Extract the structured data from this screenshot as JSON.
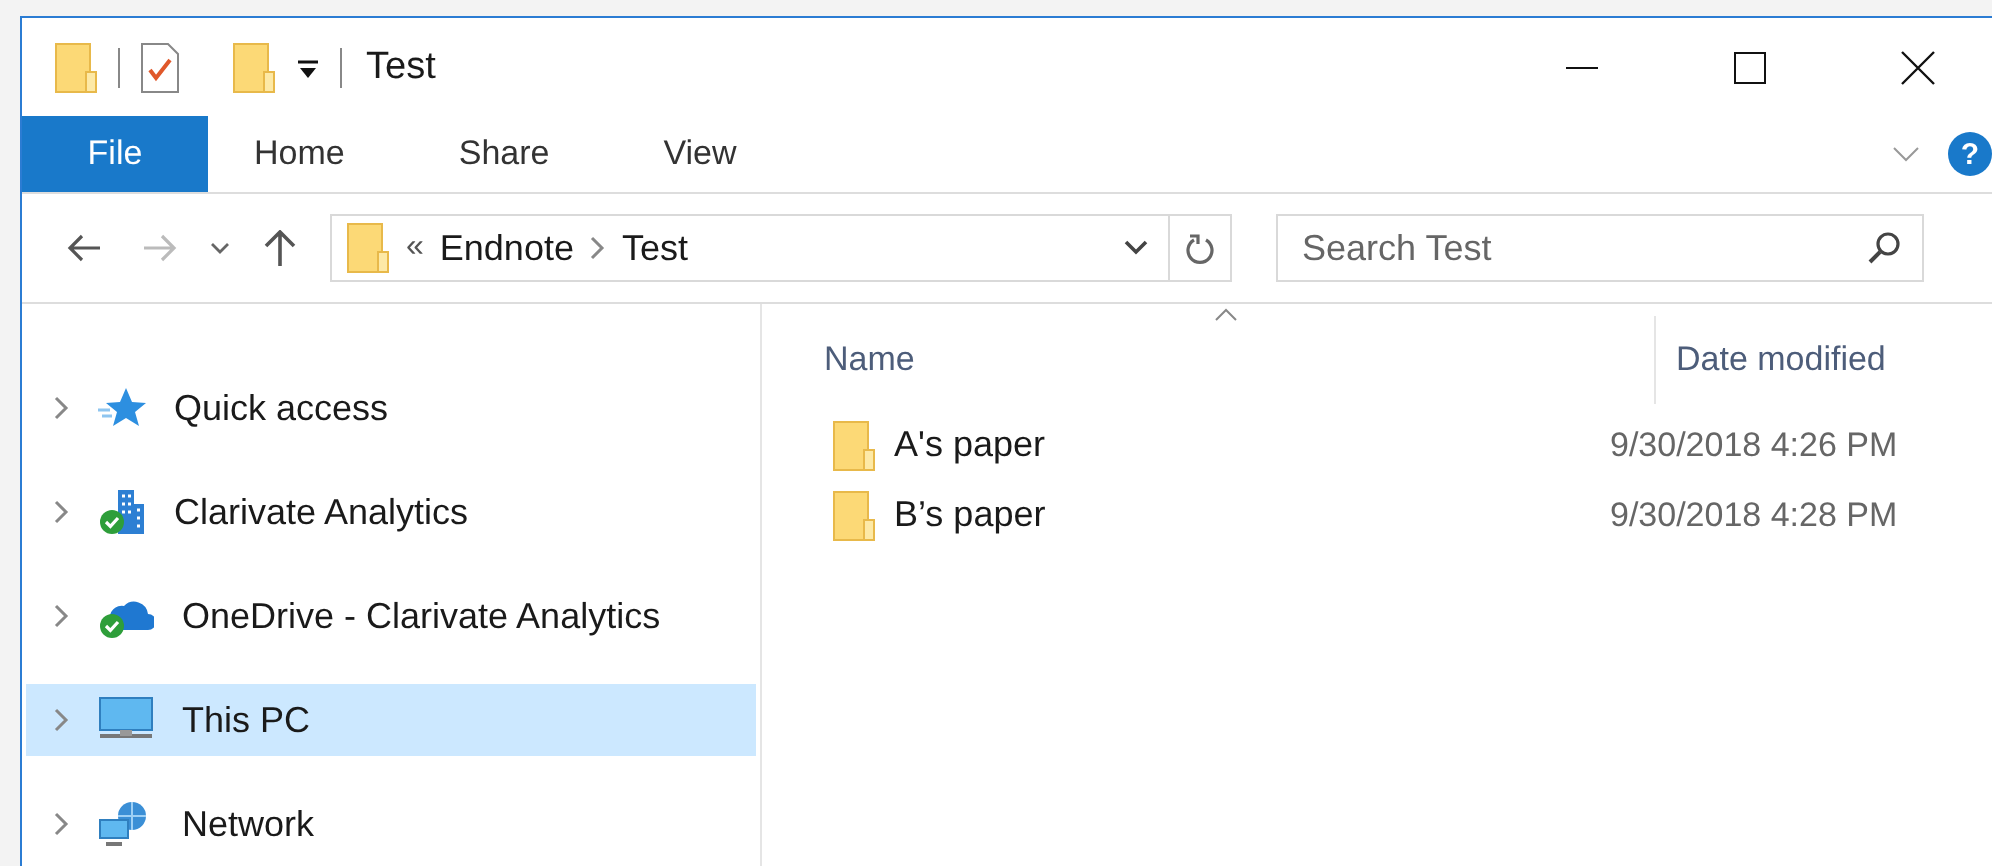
{
  "window": {
    "title": "Test"
  },
  "ribbon": {
    "tabs": [
      {
        "label": "File",
        "kind": "file",
        "selected": false
      },
      {
        "label": "Home",
        "kind": "tab",
        "selected": false
      },
      {
        "label": "Share",
        "kind": "tab",
        "selected": false
      },
      {
        "label": "View",
        "kind": "tab",
        "selected": false
      }
    ],
    "help": "?"
  },
  "address_bar": {
    "overflow": "«",
    "path": [
      "Endnote",
      "Test"
    ]
  },
  "search": {
    "placeholder": "Search Test"
  },
  "nav": [
    {
      "label": "Quick access",
      "selected": false
    },
    {
      "label": "Clarivate Analytics",
      "selected": false
    },
    {
      "label": "OneDrive - Clarivate Analytics",
      "selected": false
    },
    {
      "label": "This PC",
      "selected": true
    },
    {
      "label": "Network",
      "selected": false
    }
  ],
  "columns": [
    "Name",
    "Date modified"
  ],
  "files": [
    {
      "name": "A's paper",
      "date": "9/30/2018 4:26 PM"
    },
    {
      "name": "B’s paper",
      "date": "9/30/2018 4:28 PM"
    }
  ]
}
